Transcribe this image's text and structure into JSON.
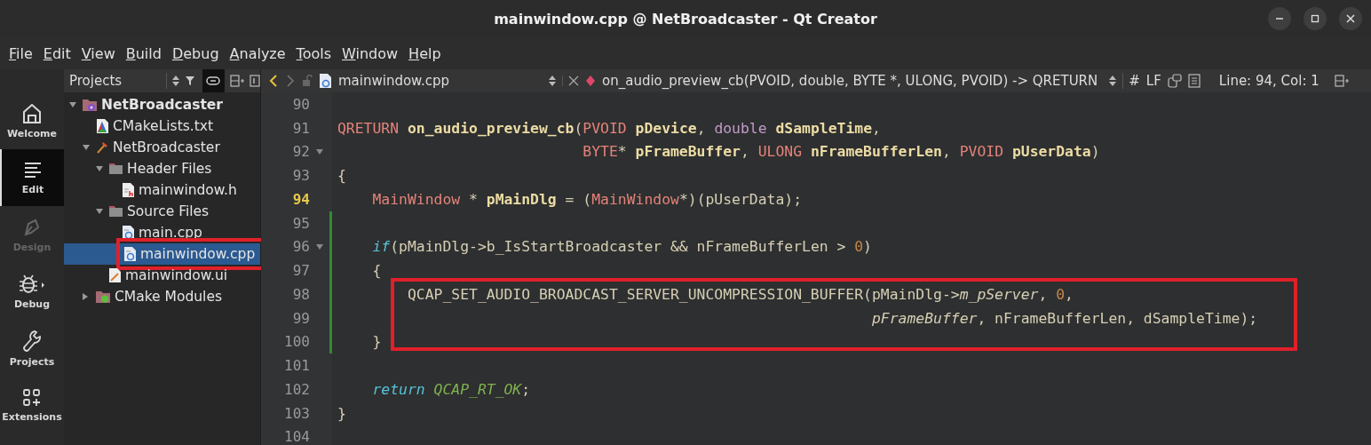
{
  "window": {
    "title": "mainwindow.cpp @ NetBroadcaster - Qt Creator"
  },
  "menu": [
    "File",
    "Edit",
    "View",
    "Build",
    "Debug",
    "Analyze",
    "Tools",
    "Window",
    "Help"
  ],
  "modes": [
    {
      "label": "Welcome",
      "kind": "welcome",
      "selected": false,
      "disabled": false
    },
    {
      "label": "Edit",
      "kind": "edit",
      "selected": true,
      "disabled": false
    },
    {
      "label": "Design",
      "kind": "design",
      "selected": false,
      "disabled": true
    },
    {
      "label": "Debug",
      "kind": "debug",
      "selected": false,
      "disabled": false
    },
    {
      "label": "Projects",
      "kind": "projects",
      "selected": false,
      "disabled": false
    },
    {
      "label": "Extensions",
      "kind": "extensions",
      "selected": false,
      "disabled": false
    }
  ],
  "project_pane": {
    "view": "Projects",
    "link_with_editor": true
  },
  "tree": [
    {
      "label": "NetBroadcaster",
      "kind": "project",
      "expanded": true,
      "selected": false,
      "highlighted": false,
      "children": [
        {
          "label": "CMakeLists.txt",
          "kind": "cmake",
          "selected": false,
          "highlighted": false
        },
        {
          "label": "NetBroadcaster",
          "kind": "target",
          "expanded": true,
          "selected": false,
          "highlighted": false,
          "children": [
            {
              "label": "Header Files",
              "kind": "folder",
              "expanded": true,
              "selected": false,
              "highlighted": false,
              "children": [
                {
                  "label": "mainwindow.h",
                  "kind": "header",
                  "selected": false,
                  "highlighted": false
                }
              ]
            },
            {
              "label": "Source Files",
              "kind": "folder",
              "expanded": true,
              "selected": false,
              "highlighted": false,
              "children": [
                {
                  "label": "main.cpp",
                  "kind": "source",
                  "selected": false,
                  "highlighted": false
                },
                {
                  "label": "mainwindow.cpp",
                  "kind": "source",
                  "selected": true,
                  "highlighted": true
                }
              ]
            },
            {
              "label": "mainwindow.ui",
              "kind": "ui",
              "selected": false,
              "highlighted": false
            }
          ]
        },
        {
          "label": "CMake Modules",
          "kind": "modules",
          "expanded": false,
          "selected": false,
          "highlighted": false
        }
      ]
    }
  ],
  "editor_toolbar": {
    "file": "mainwindow.cpp",
    "symbol": "on_audio_preview_cb(PVOID, double, BYTE *, ULONG, PVOID) -> QRETURN",
    "encoding_mark": "#",
    "line_ending": "LF",
    "position": "Line: 94, Col: 1"
  },
  "code": [
    {
      "number": "90",
      "current": false,
      "fold": false,
      "modified": false
    },
    {
      "number": "91",
      "current": false,
      "fold": false,
      "modified": false,
      "tokens": [
        {
          "kind": "type",
          "t": "QRETURN"
        },
        {
          "kind": "bold",
          "t": " on_audio_preview_cb"
        },
        {
          "kind": "plain",
          "t": "("
        },
        {
          "kind": "type",
          "t": "PVOID"
        },
        {
          "kind": "bold",
          "t": " pDevice"
        },
        {
          "kind": "plain",
          "t": ", "
        },
        {
          "kind": "keyword",
          "t": "double"
        },
        {
          "kind": "bold",
          "t": " dSampleTime"
        },
        {
          "kind": "plain",
          "t": ","
        }
      ]
    },
    {
      "number": "92",
      "current": false,
      "fold": true,
      "modified": false,
      "tokens": [
        {
          "kind": "type",
          "t": "                            BYTE"
        },
        {
          "kind": "plain",
          "t": "* "
        },
        {
          "kind": "bold",
          "t": "pFrameBuffer"
        },
        {
          "kind": "plain",
          "t": ", "
        },
        {
          "kind": "type",
          "t": "ULONG"
        },
        {
          "kind": "bold",
          "t": " nFrameBufferLen"
        },
        {
          "kind": "plain",
          "t": ", "
        },
        {
          "kind": "type",
          "t": "PVOID"
        },
        {
          "kind": "bold",
          "t": " pUserData"
        },
        {
          "kind": "plain",
          "t": ")"
        }
      ]
    },
    {
      "number": "93",
      "current": false,
      "fold": false,
      "modified": false,
      "tokens": [
        {
          "kind": "plain",
          "t": "{"
        }
      ]
    },
    {
      "number": "94",
      "current": true,
      "fold": false,
      "modified": false,
      "tokens": [
        {
          "kind": "type",
          "t": "    MainWindow"
        },
        {
          "kind": "plain",
          "t": " * "
        },
        {
          "kind": "bold",
          "t": "pMainDlg"
        },
        {
          "kind": "plain",
          "t": " = ("
        },
        {
          "kind": "type",
          "t": "MainWindow"
        },
        {
          "kind": "plain",
          "t": "*)(pUserData);"
        }
      ]
    },
    {
      "number": "95",
      "current": false,
      "fold": false,
      "modified": true
    },
    {
      "number": "96",
      "current": false,
      "fold": true,
      "modified": true,
      "tokens": [
        {
          "kind": "flow",
          "t": "    if"
        },
        {
          "kind": "plain",
          "t": "(pMainDlg->b_IsStartBroadcaster && nFrameBufferLen > "
        },
        {
          "kind": "number",
          "t": "0"
        },
        {
          "kind": "plain",
          "t": ")"
        }
      ]
    },
    {
      "number": "97",
      "current": false,
      "fold": false,
      "modified": true,
      "tokens": [
        {
          "kind": "plain",
          "t": "    {"
        }
      ]
    },
    {
      "number": "98",
      "current": false,
      "fold": false,
      "modified": true,
      "highlighted": true,
      "tokens": [
        {
          "kind": "plain",
          "t": "        QCAP_SET_AUDIO_BROADCAST_SERVER_UNCOMPRESSION_BUFFER(pMainDlg->"
        },
        {
          "kind": "italic",
          "t": "m_pServer"
        },
        {
          "kind": "plain",
          "t": ", "
        },
        {
          "kind": "number",
          "t": "0"
        },
        {
          "kind": "plain",
          "t": ","
        }
      ]
    },
    {
      "number": "99",
      "current": false,
      "fold": false,
      "modified": true,
      "highlighted": true,
      "tokens": [
        {
          "kind": "italic",
          "t": "                                                             pFrameBuffer"
        },
        {
          "kind": "plain",
          "t": ", nFrameBufferLen, dSampleTime);"
        }
      ]
    },
    {
      "number": "100",
      "current": false,
      "fold": false,
      "modified": true,
      "tokens": [
        {
          "kind": "plain",
          "t": "    }"
        }
      ]
    },
    {
      "number": "101",
      "current": false,
      "fold": false,
      "modified": false
    },
    {
      "number": "102",
      "current": false,
      "fold": false,
      "modified": false,
      "tokens": [
        {
          "kind": "flow",
          "t": "    return"
        },
        {
          "kind": "constant",
          "t": " QCAP_RT_OK"
        },
        {
          "kind": "plain",
          "t": ";"
        }
      ]
    },
    {
      "number": "103",
      "current": false,
      "fold": false,
      "modified": false,
      "tokens": [
        {
          "kind": "plain",
          "t": "}"
        }
      ]
    },
    {
      "number": "104",
      "current": false,
      "fold": false,
      "modified": false
    }
  ]
}
